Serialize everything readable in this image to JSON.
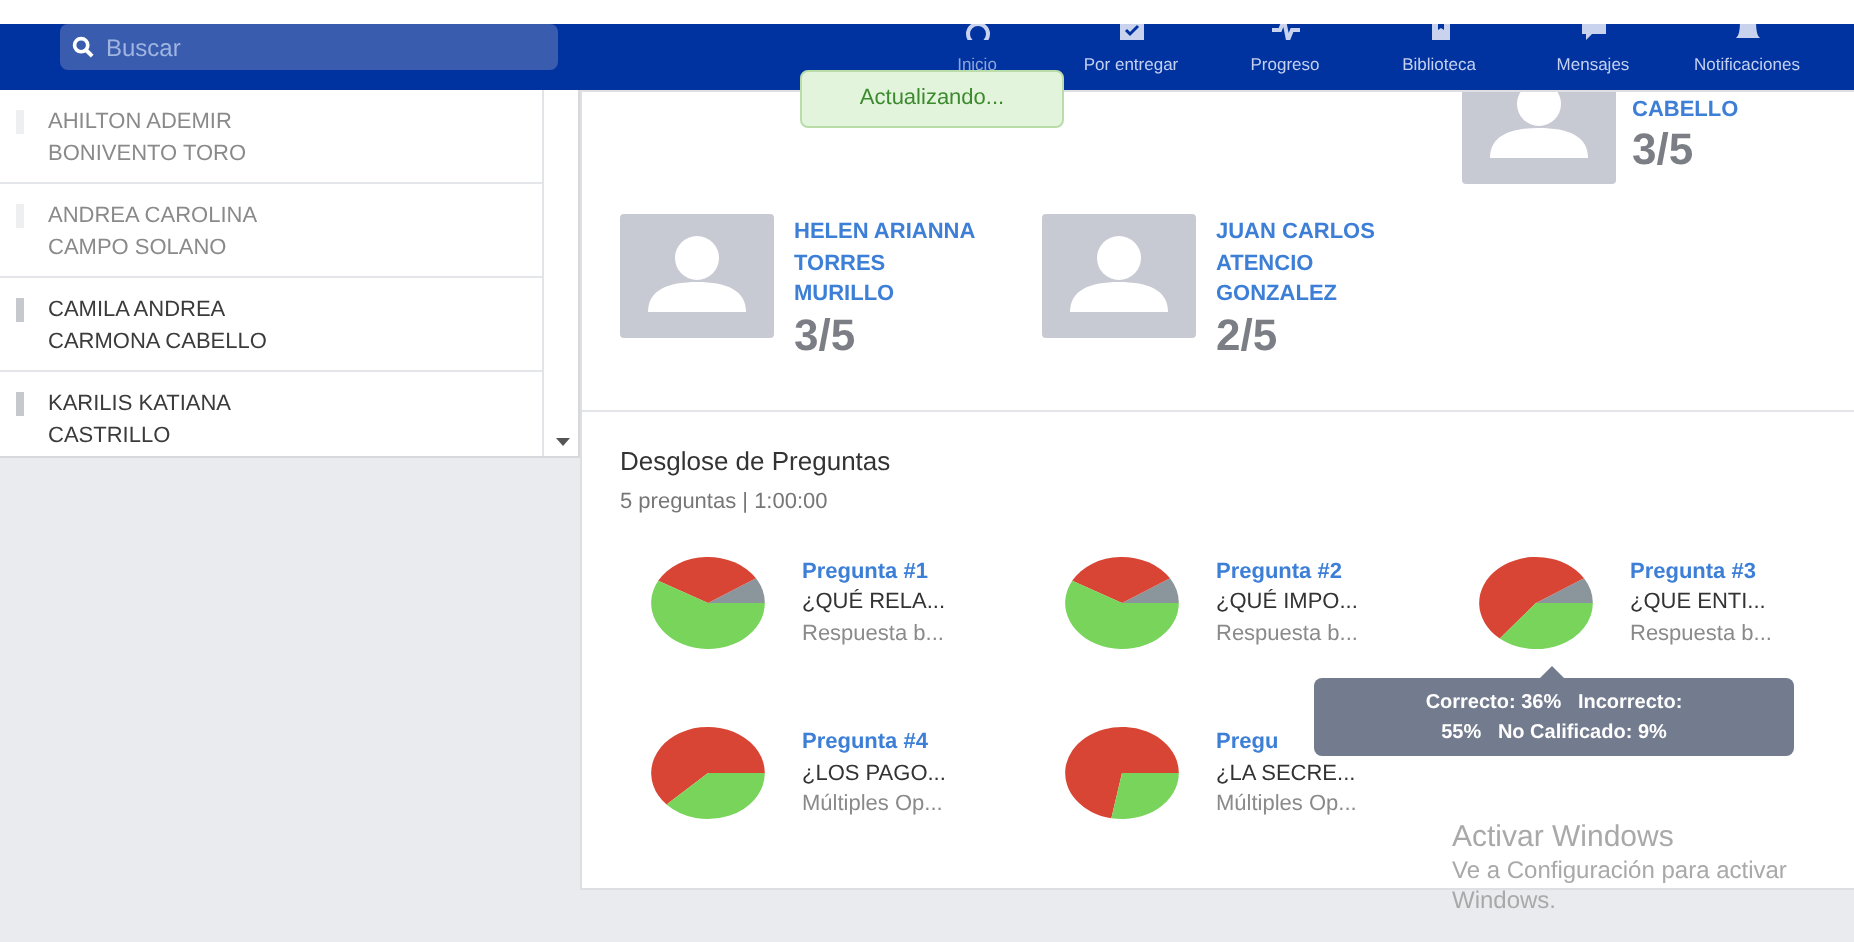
{
  "search": {
    "placeholder": "Buscar"
  },
  "nav": [
    {
      "label": "Inicio",
      "selected": true
    },
    {
      "label": "Por entregar",
      "selected": false
    },
    {
      "label": "Progreso",
      "selected": false
    },
    {
      "label": "Biblioteca",
      "selected": false
    },
    {
      "label": "Mensajes",
      "selected": false
    },
    {
      "label": "Notificaciones",
      "selected": false
    }
  ],
  "toast": "Actualizando...",
  "students": [
    {
      "first": "AHILTON ADEMIR",
      "last": "BONIVENTO TORO",
      "dimmed": true
    },
    {
      "first": "ANDREA CAROLINA",
      "last": "CAMPO SOLANO",
      "dimmed": true
    },
    {
      "first": "CAMILA ANDREA",
      "last": "CARMONA CABELLO",
      "dimmed": false
    },
    {
      "first": "KARILIS KATIANA",
      "last": "CASTRILLO",
      "dimmed": false
    }
  ],
  "partial_card": {
    "name": "CABELLO",
    "score": "3/5"
  },
  "cards": [
    {
      "name": [
        "HELEN ARIANNA",
        "TORRES",
        "MURILLO"
      ],
      "score": "3/5"
    },
    {
      "name": [
        "JUAN CARLOS",
        "ATENCIO",
        "GONZALEZ"
      ],
      "score": "2/5"
    }
  ],
  "breakdown": {
    "title": "Desglose de Preguntas",
    "subtitle": "5 preguntas | 1:00:00",
    "questions": [
      {
        "title": "Pregunta #1",
        "text": "¿QUÉ RELA...",
        "type": "Respuesta b..."
      },
      {
        "title": "Pregunta #2",
        "text": "¿QUÉ IMPO...",
        "type": "Respuesta b..."
      },
      {
        "title": "Pregunta #3",
        "text": "¿QUE ENTI...",
        "type": "Respuesta b..."
      },
      {
        "title": "Pregunta #4",
        "text": "¿LOS PAGO...",
        "type": "Múltiples Op..."
      },
      {
        "title": "Pregu",
        "text": "¿LA SECRE...",
        "type": "Múltiples Op..."
      }
    ]
  },
  "tooltip": {
    "lines": [
      "Correcto: 36%   Incorrecto:",
      "55%   No Calificado: 9%"
    ]
  },
  "os_notice": {
    "title": "Activar Windows",
    "text": "Ve a Configuración para activar",
    "text_2": "Windows."
  }
}
